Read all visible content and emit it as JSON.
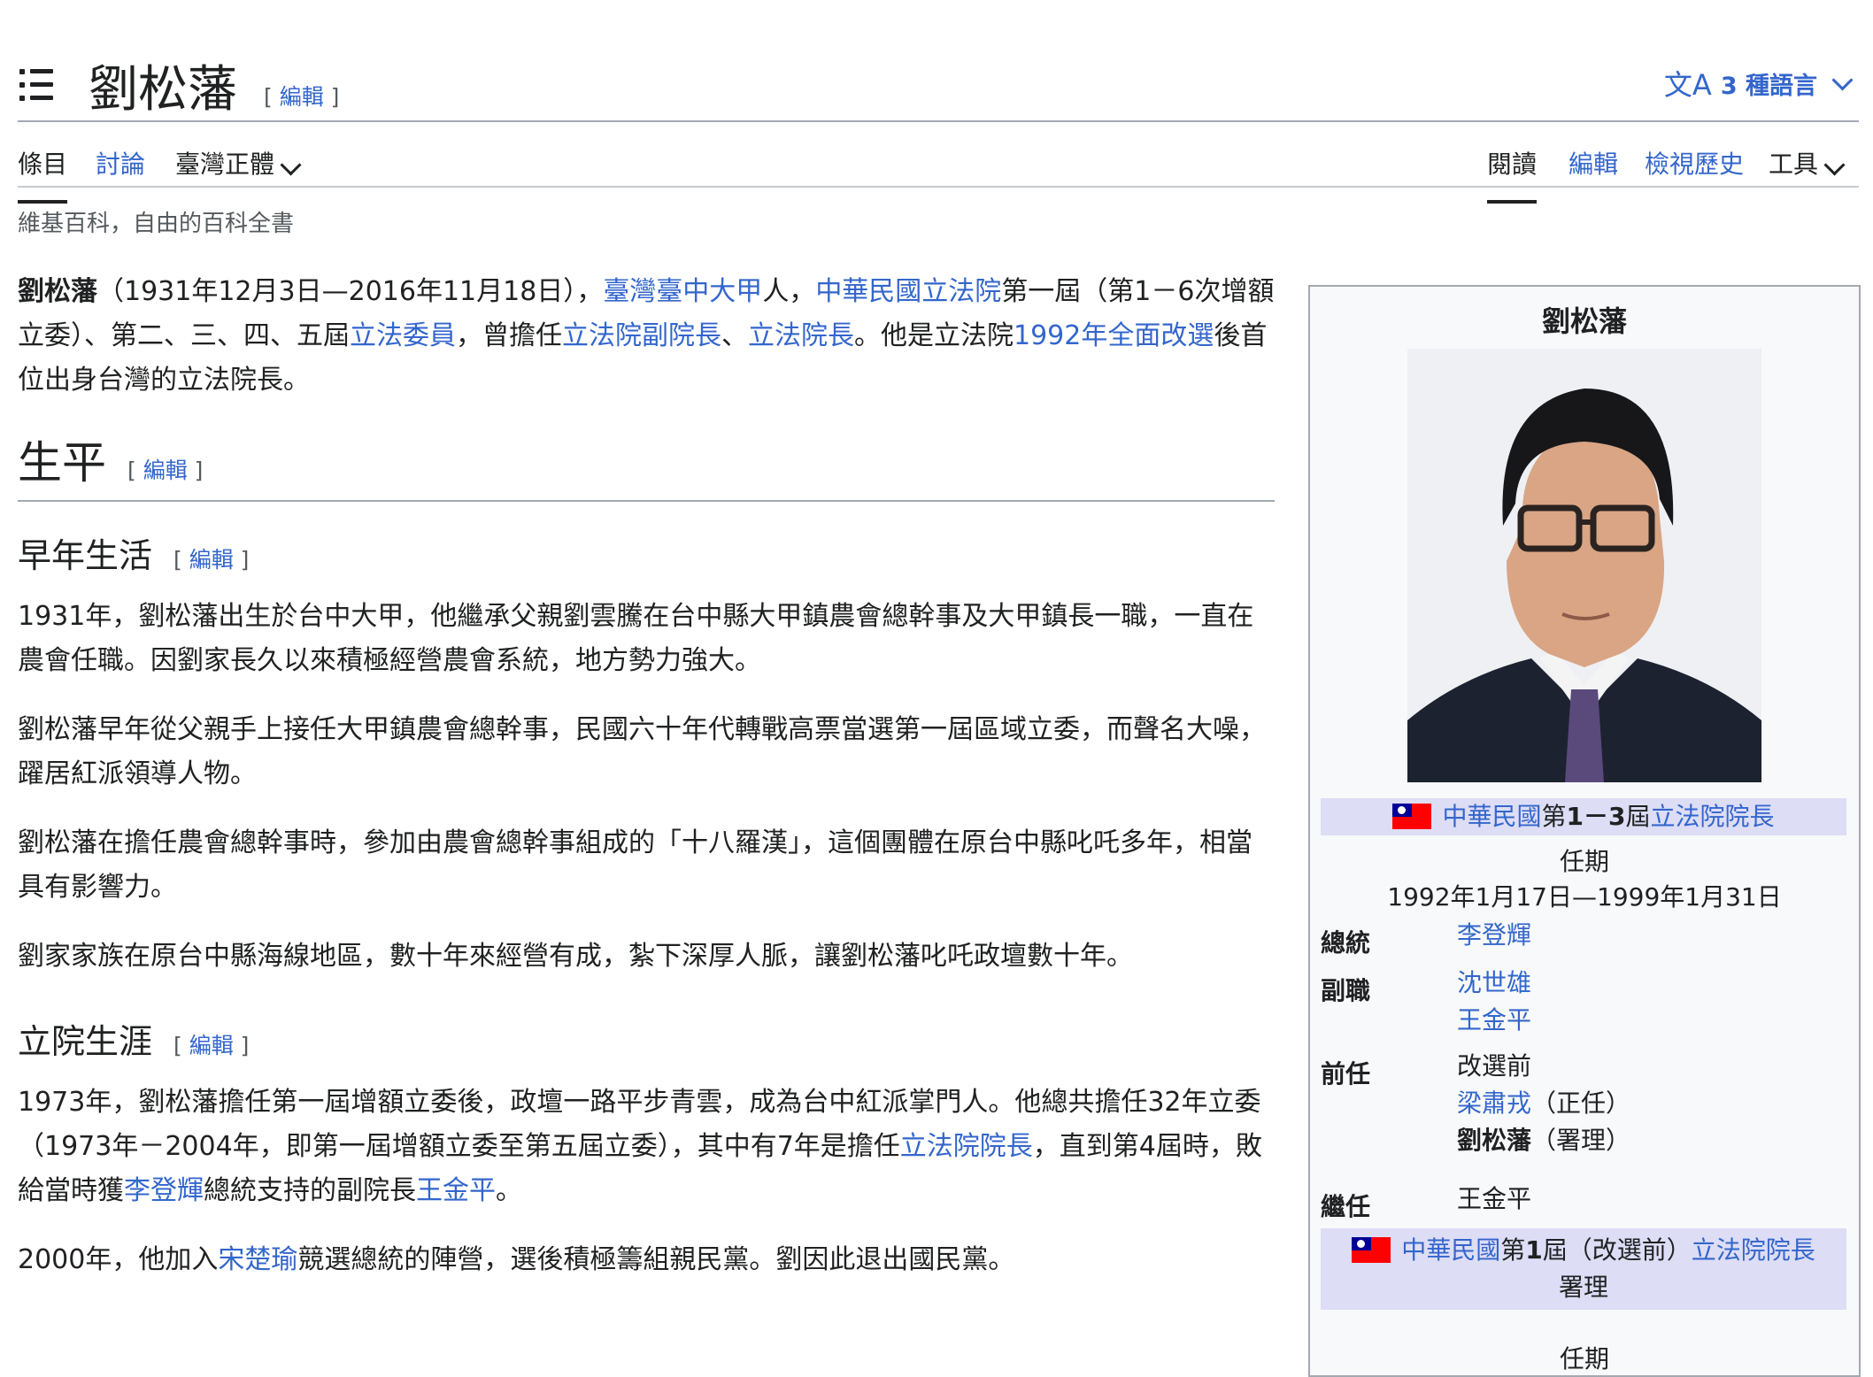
{
  "header": {
    "title": "劉松藩",
    "edit_label": "編輯",
    "language_button": "3 種語言",
    "language_icon": "文A"
  },
  "tabs": {
    "article": "條目",
    "talk": "討論",
    "variant": "臺灣正體",
    "read": "閱讀",
    "edit": "編輯",
    "history": "檢視歷史",
    "tools": "工具"
  },
  "tagline": "維基百科，自由的百科全書",
  "lead": {
    "name": "劉松藩",
    "t1": "（1931年12月3日—2016年11月18日），",
    "l1": "臺灣臺中大甲",
    "t2": "人，",
    "l2": "中華民國立法院",
    "t3": "第一屆（第1－6次增額立委）、第二、三、四、五屆",
    "l3": "立法委員",
    "t4": "，曾擔任",
    "l4": "立法院副院長",
    "t5": "、",
    "l5": "立法院長",
    "t6": "。他是立法院",
    "l6": "1992年全面改選",
    "t7": "後首位出身台灣的立法院長。"
  },
  "sections": {
    "biography": "生平",
    "early_life": "早年生活",
    "legislative_career": "立院生涯"
  },
  "early_life": {
    "p1": "1931年，劉松藩出生於台中大甲，他繼承父親劉雲騰在台中縣大甲鎮農會總幹事及大甲鎮長一職，一直在農會任職。因劉家長久以來積極經營農會系統，地方勢力強大。",
    "p2": "劉松藩早年從父親手上接任大甲鎮農會總幹事，民國六十年代轉戰高票當選第一屆區域立委，而聲名大噪，躍居紅派領導人物。",
    "p3": "劉松藩在擔任農會總幹事時，參加由農會總幹事組成的「十八羅漢」，這個團體在原台中縣叱吒多年，相當具有影響力。",
    "p4": "劉家家族在原台中縣海線地區，數十年來經營有成，紮下深厚人脈，讓劉松藩叱吒政壇數十年。"
  },
  "career": {
    "p1_t1": "1973年，劉松藩擔任第一屆增額立委後，政壇一路平步青雲，成為台中紅派掌門人。他總共擔任32年立委（1973年－2004年，即第一屆增額立委至第五屆立委），其中有7年是擔任",
    "p1_l1": "立法院院長",
    "p1_t2": "，直到第4屆時，敗給當時獲",
    "p1_l2": "李登輝",
    "p1_t3": "總統支持的副院長",
    "p1_l3": "王金平",
    "p1_t4": "。",
    "p2_t1": "2000年，他加入",
    "p2_l1": "宋楚瑜",
    "p2_t2": "競選總統的陣營，選後積極籌組親民黨。劉因此退出國民黨。"
  },
  "infobox": {
    "title": "劉松藩",
    "office1": {
      "link1": "中華民國",
      "text": "第",
      "bold": "1－3",
      "text2": "屆",
      "link2": "立法院院長"
    },
    "term_label": "任期",
    "term1": "1992年1月17日—1999年1月31日",
    "president_label": "總統",
    "president": "李登輝",
    "deputy_label": "副職",
    "deputy1": "沈世雄",
    "deputy2": "王金平",
    "predecessor_label": "前任",
    "pred_note": "改選前",
    "pred1": "梁肅戎",
    "pred1_note": "（正任）",
    "pred2": "劉松藩",
    "pred2_note": "（署理）",
    "successor_label": "繼任",
    "successor": "王金平",
    "office2": {
      "link1": "中華民國",
      "text": "第",
      "bold": "1",
      "text2": "屆（改選前）",
      "link2": "立法院院長",
      "sub": "署理"
    },
    "term2_label": "任期"
  },
  "colors": {
    "link": "#3366cc",
    "infobox_header": "#ddddf6",
    "border": "#a2a9b1"
  }
}
